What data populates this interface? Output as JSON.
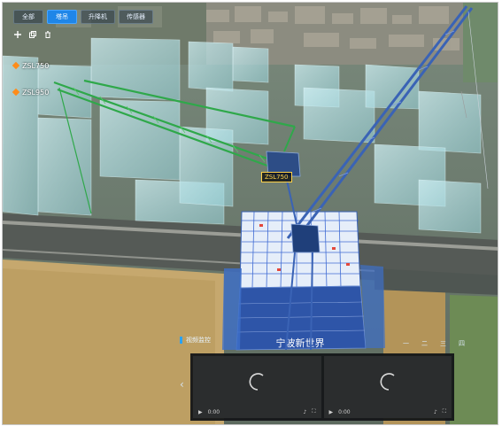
{
  "tabs": [
    {
      "label": "全部",
      "active": false
    },
    {
      "label": "塔吊",
      "active": true
    },
    {
      "label": "升降机",
      "active": false
    },
    {
      "label": "传感器",
      "active": false
    }
  ],
  "toolbar": {
    "icons": [
      "add-icon",
      "copy-icon",
      "delete-icon"
    ]
  },
  "cranes": [
    {
      "label": "ZSL750",
      "marker_color": "#ff8c1a"
    },
    {
      "label": "ZSL950",
      "marker_color": "#ff8c1a"
    }
  ],
  "crane_tag": "ZSL750",
  "building_sign": "宁波新世界",
  "video": {
    "title": "视频监控",
    "pages": [
      "一",
      "二",
      "三",
      "四"
    ],
    "players": [
      {
        "time": "0:00"
      },
      {
        "time": "0:00"
      }
    ]
  },
  "colors": {
    "accent": "#1f86e8",
    "crane_green": "#2fa84a",
    "crane_blue": "#3a63b5",
    "marker": "#ff8c1a",
    "tag": "#ffd24a"
  }
}
